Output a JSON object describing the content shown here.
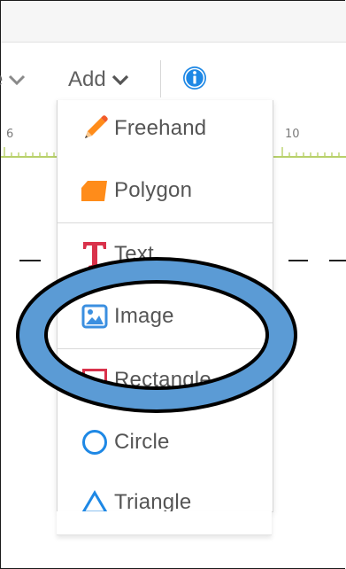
{
  "toolbar": {
    "partial_label": "e",
    "add_label": "Add",
    "info_icon": "info-icon"
  },
  "ruler": {
    "labels": [
      "6",
      "10"
    ]
  },
  "add_menu": {
    "items": [
      {
        "label": "Freehand",
        "icon": "pencil-icon"
      },
      {
        "label": "Polygon",
        "icon": "polygon-icon"
      },
      {
        "label": "Text",
        "icon": "text-icon"
      },
      {
        "label": "Image",
        "icon": "image-icon"
      },
      {
        "label": "Rectangle",
        "icon": "rectangle-icon"
      },
      {
        "label": "Circle",
        "icon": "circle-icon"
      },
      {
        "label": "Triangle",
        "icon": "triangle-icon"
      }
    ]
  },
  "colors": {
    "accent_blue": "#1e88e5",
    "pencil_orange": "#ff8c1a",
    "text_red": "#d9324b",
    "highlight_fill": "#5b9bd5",
    "ruler_green": "#b8d16a"
  }
}
